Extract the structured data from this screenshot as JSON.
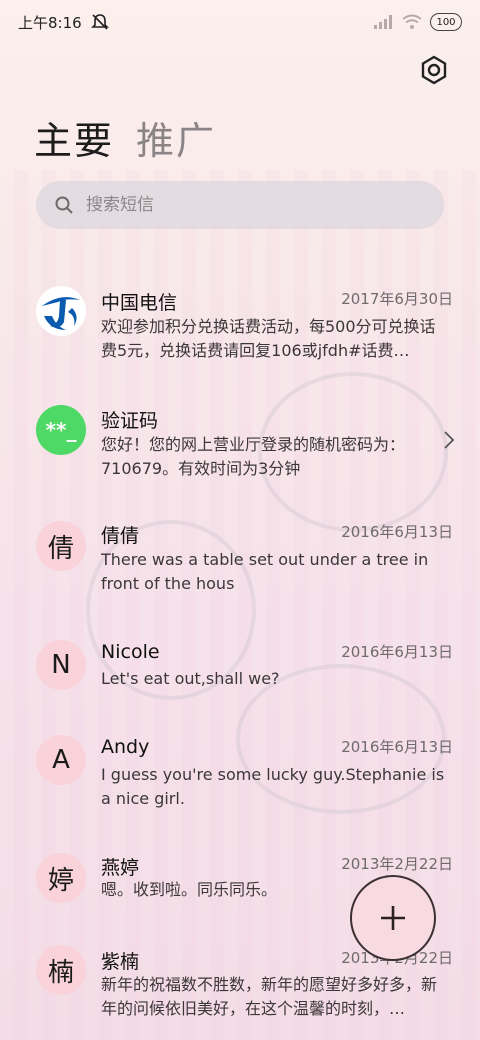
{
  "status_bar": {
    "time": "上午8:16",
    "battery": "100"
  },
  "tabs": [
    {
      "label": "主要",
      "active": true
    },
    {
      "label": "推广",
      "active": false
    }
  ],
  "search": {
    "placeholder": "搜索短信"
  },
  "messages": [
    {
      "name": "中国电信",
      "date": "2017年6月30日",
      "text": "欢迎参加积分兑换话费活动，每500分可兑换话费5元，兑换话费请回复106或jfdh#话费…",
      "avatar": "telecom-logo-icon"
    },
    {
      "name": "验证码",
      "date": "",
      "text": "您好！您的网上营业厅登录的随机密码为：710679。有效时间为3分钟",
      "avatar_text": "**_"
    },
    {
      "name": "倩倩",
      "date": "2016年6月13日",
      "text": "There was a table set out under a tree in front of the hous",
      "avatar_text": "倩"
    },
    {
      "name": "Nicole",
      "date": "2016年6月13日",
      "text": "Let's eat out,shall we?",
      "avatar_text": "N"
    },
    {
      "name": "Andy",
      "date": "2016年6月13日",
      "text": "I guess you're some lucky guy.Stephanie is a nice girl.",
      "avatar_text": "A"
    },
    {
      "name": "燕婷",
      "date": "2013年2月22日",
      "text": "嗯。收到啦。同乐同乐。",
      "avatar_text": "婷"
    },
    {
      "name": "紫楠",
      "date": "2013年2月22日",
      "text": "新年的祝福数不胜数，新年的愿望好多好多，新年的问候依旧美好，在这个温馨的时刻，…",
      "avatar_text": "楠"
    }
  ],
  "colors": {
    "avatar_pink": "#f9d2da",
    "avatar_green": "#4ed865",
    "fab_bg": "#f8dbe2"
  }
}
